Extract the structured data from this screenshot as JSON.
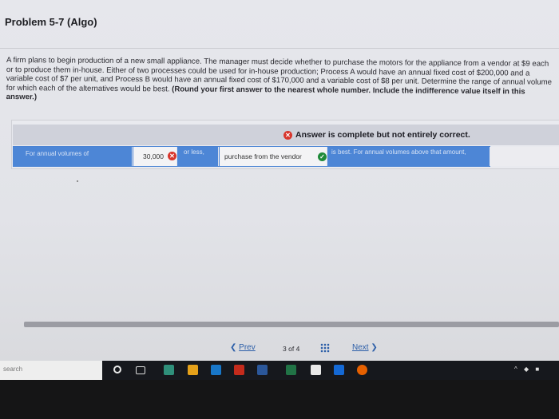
{
  "header": {
    "title": "Problem 5-7 (Algo)"
  },
  "problem": {
    "text": "A firm plans to begin production of a new small appliance. The manager must decide whether to purchase the motors for the appliance from a vendor at $9 each or to produce them in-house. Either of two processes could be used for in-house production; Process A would have an annual fixed cost of $200,000 and a variable cost of $7 per unit, and Process B would have an annual fixed cost of $170,000 and a variable cost of $8 per unit. Determine the range of annual volume for which each of the alternatives would be best.",
    "instruction": "(Round your first answer to the nearest whole number. Include the indifference value itself in this answer.)"
  },
  "answer": {
    "status": "Answer is complete but not entirely correct.",
    "row": {
      "label": "For annual volumes of",
      "volume": "30,000",
      "or_less": "or less,",
      "choice": "purchase from the vendor",
      "tail": "is best. For annual volumes above that amount,"
    }
  },
  "pager": {
    "prev": "Prev",
    "page": "3",
    "of": "of",
    "total": "4",
    "next": "Next"
  },
  "taskbar": {
    "search": "search"
  },
  "colors": {
    "incorrect": "#d8362d",
    "correct": "#1f8a3a",
    "answer_row": "#4a83d4",
    "link": "#2c5ea8"
  }
}
